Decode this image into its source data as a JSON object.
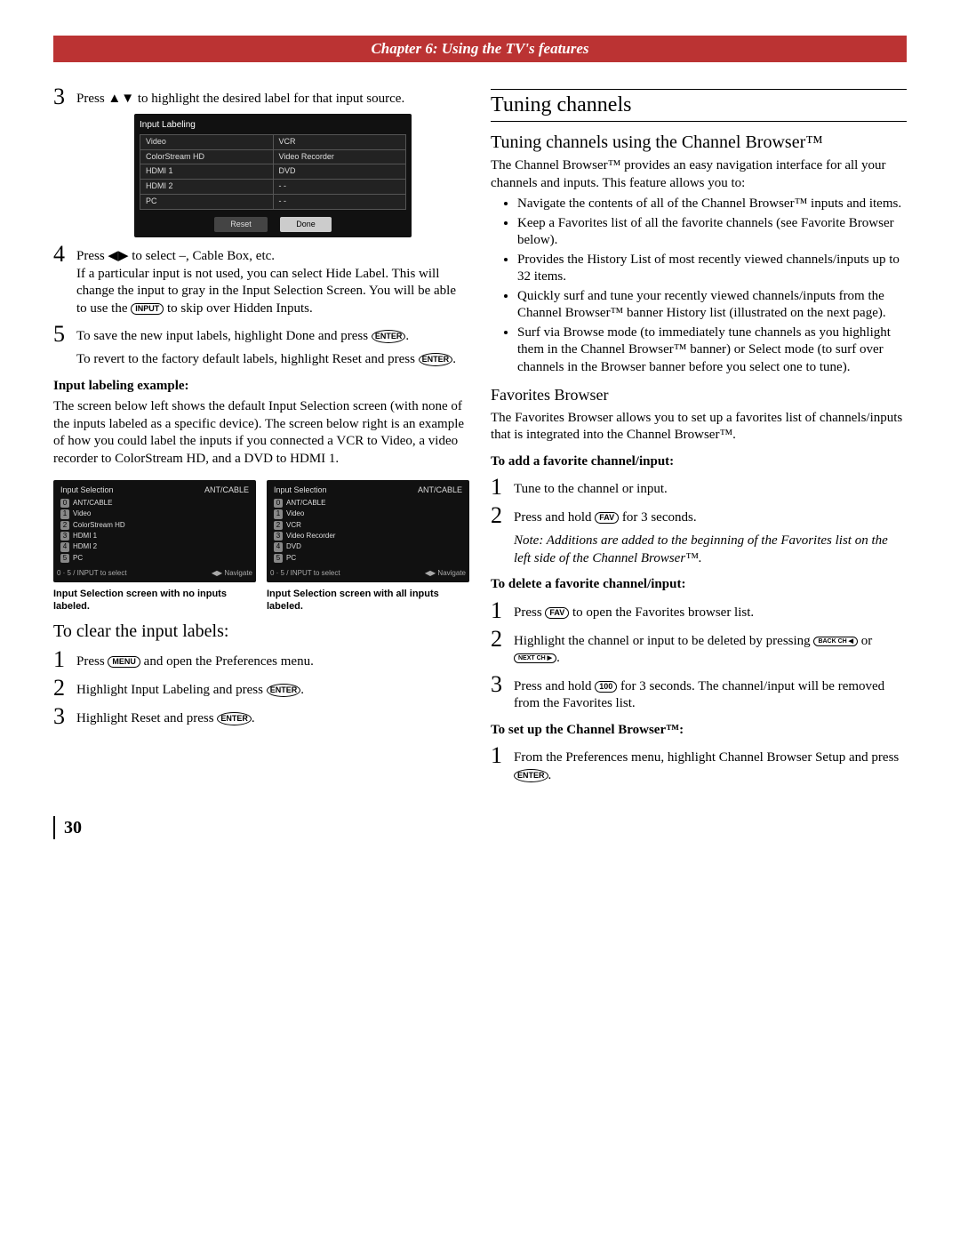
{
  "chapter_bar": "Chapter 6: Using the TV's features",
  "left": {
    "step3_txt": "Press ▲▼ to highlight the desired label for that input source.",
    "input_labeling_box": {
      "title": "Input Labeling",
      "rows": [
        [
          "Video",
          "VCR"
        ],
        [
          "ColorStream HD",
          "Video Recorder"
        ],
        [
          "HDMI 1",
          "DVD"
        ],
        [
          "HDMI 2",
          "- -"
        ],
        [
          "PC",
          "- -"
        ]
      ],
      "btn_reset": "Reset",
      "btn_done": "Done"
    },
    "step4_txt_a": "Press ◀▶ to select –, Cable Box, etc.",
    "step4_txt_b": "If a particular input is not used, you can select Hide Label. This will change the input to gray in the Input Selection Screen. You will be able to use the",
    "step4_input_icon": "INPUT",
    "step4_txt_c": "to skip over Hidden Inputs.",
    "step5_txt_a": "To save the new input labels, highlight Done and press",
    "step5_enter": "ENTER",
    "step5_txt_b": ".",
    "reset_line_a": "To revert to the factory default labels, highlight Reset and press",
    "reset_enter": "ENTER",
    "reset_line_b": ".",
    "example_heading": "Input labeling example:",
    "example_para": "The screen below left shows the default Input Selection screen (with none of the inputs labeled as a specific device). The screen below right is an example of how you could label the inputs if you connected a VCR to Video, a video recorder to ColorStream HD, and a DVD to HDMI 1.",
    "screen_hdr_title": "Input Selection",
    "screen_hdr_right": "ANT/CABLE",
    "screen_left_rows": [
      "ANT/CABLE",
      "Video",
      "ColorStream HD",
      "HDMI 1",
      "HDMI 2",
      "PC"
    ],
    "screen_right_rows": [
      "ANT/CABLE",
      "Video",
      "VCR",
      "Video Recorder",
      "DVD",
      "PC"
    ],
    "screen_ftr_left": "0 · 5 / INPUT to select",
    "screen_ftr_right": "◀▶ Navigate",
    "cap_left": "Input Selection screen with no inputs labeled.",
    "cap_right": "Input Selection screen with all inputs labeled.",
    "clear_heading": "To clear the input labels:",
    "clear1_a": "Press",
    "clear1_menu": "MENU",
    "clear1_b": "and open the Preferences menu.",
    "clear2_a": "Highlight Input Labeling and press",
    "clear2_enter": "ENTER",
    "clear2_b": ".",
    "clear3_a": "Highlight Reset and press",
    "clear3_enter": "ENTER",
    "clear3_b": "."
  },
  "right": {
    "h1": "Tuning channels",
    "h2": "Tuning channels using the Channel Browser™",
    "para1": "The Channel Browser™ provides an easy navigation interface for all your channels and inputs. This feature allows you to:",
    "bullets": [
      "Navigate the contents of all of the Channel Browser™ inputs and items.",
      "Keep a Favorites list of all the favorite channels (see Favorite Browser below).",
      "Provides the History List of most recently viewed channels/inputs up to 32 items.",
      "Quickly surf and tune your recently viewed channels/inputs from the Channel Browser™ banner History list (illustrated on the next page).",
      "Surf via Browse mode (to immediately tune channels as you highlight them in the Channel Browser™ banner) or Select mode (to surf over channels in the Browser banner before you select one to tune)."
    ],
    "fav_heading": "Favorites Browser",
    "fav_para": "The Favorites Browser allows you to set up a favorites list of channels/inputs that is integrated into the Channel Browser™.",
    "add_title": "To add a favorite channel/input:",
    "add1": "Tune to the channel or input.",
    "add2_a": "Press and hold",
    "add2_fav": "FAV",
    "add2_b": "for 3 seconds.",
    "add_note": "Note: Additions are added to the beginning of the Favorites list on the left side of the Channel Browser™.",
    "del_title": "To delete a favorite channel/input:",
    "del1_a": "Press",
    "del1_fav": "FAV",
    "del1_b": "to open the Favorites browser list.",
    "del2_a": "Highlight the channel or input to be deleted by pressing",
    "del2_back": "BACK CH ◀",
    "del2_b": "or",
    "del2_next": "NEXT CH ▶",
    "del2_c": ".",
    "del3_a": "Press and hold",
    "del3_100": "100",
    "del3_b": "for 3 seconds. The channel/input will be removed from the Favorites list.",
    "setup_title": "To set up the Channel Browser™:",
    "setup1_a": "From the Preferences menu, highlight Channel Browser Setup and press",
    "setup1_enter": "ENTER",
    "setup1_b": "."
  },
  "page_num": "30"
}
